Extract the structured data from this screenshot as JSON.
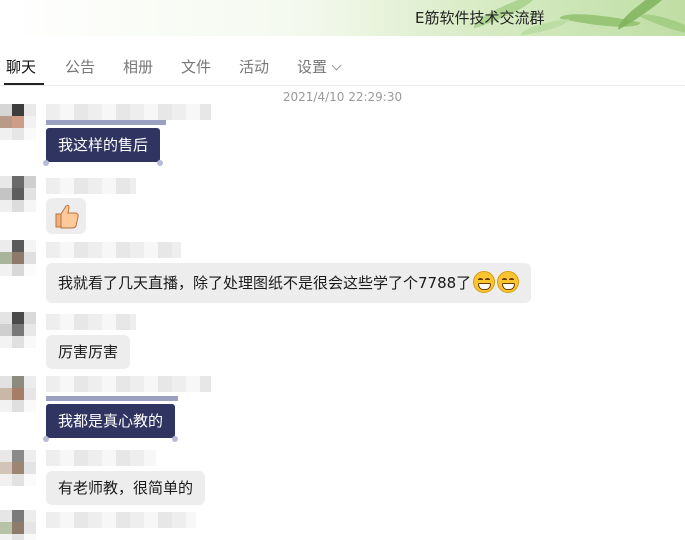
{
  "window": {
    "title": "E筋软件技术交流群"
  },
  "tabs": [
    {
      "label": "聊天",
      "active": true
    },
    {
      "label": "公告"
    },
    {
      "label": "相册"
    },
    {
      "label": "文件"
    },
    {
      "label": "活动"
    },
    {
      "label": "设置"
    }
  ],
  "chat": {
    "timestamp": "2021/4/10 22:29:30",
    "messages": [
      {
        "text": "我这样的售后",
        "style": "dark"
      },
      {
        "text": "",
        "sticker": "thumbs-up-icon"
      },
      {
        "text": "我就看了几天直播，除了处理图纸不是很会这些学了个7788了",
        "emoji": [
          "grin-icon",
          "grin-icon"
        ]
      },
      {
        "text": "厉害厉害"
      },
      {
        "text": "我都是真心教的",
        "style": "dark"
      },
      {
        "text": "有老师教，很简单的"
      }
    ]
  },
  "colors": {
    "dark_bubble": "#2f3560",
    "light_bubble": "#ededed",
    "accent_green": "#bfdea4"
  }
}
